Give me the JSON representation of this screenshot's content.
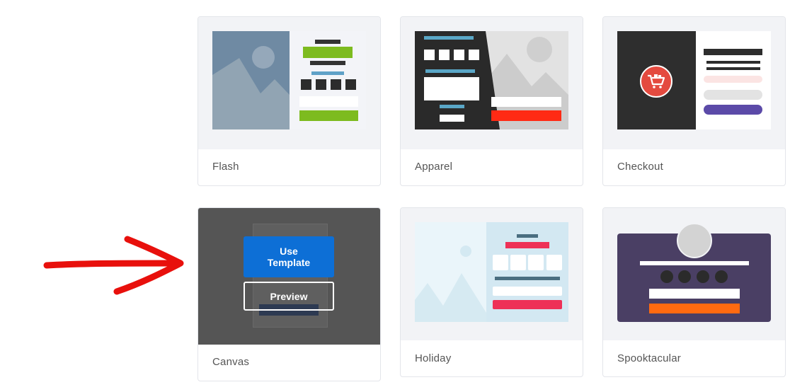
{
  "templates": [
    {
      "name": "Flash"
    },
    {
      "name": "Apparel"
    },
    {
      "name": "Checkout"
    },
    {
      "name": "Canvas"
    },
    {
      "name": "Holiday"
    },
    {
      "name": "Spooktacular"
    }
  ],
  "hover_actions": {
    "use_template_label": "Use\nTemplate",
    "preview_label": "Preview"
  },
  "colors": {
    "accent_blue": "#0d6fd6",
    "annotation_arrow": "#e8100c",
    "flash_green": "#7dbb1f",
    "apparel_red": "#ff2a14",
    "checkout_purple": "#5b4aa8",
    "holiday_red": "#ee3157",
    "spooky_orange": "#ff6a10",
    "spooky_bg": "#4a3f64"
  },
  "icons": {
    "checkout": "cart-icon",
    "annotation": "arrow-right-icon"
  }
}
